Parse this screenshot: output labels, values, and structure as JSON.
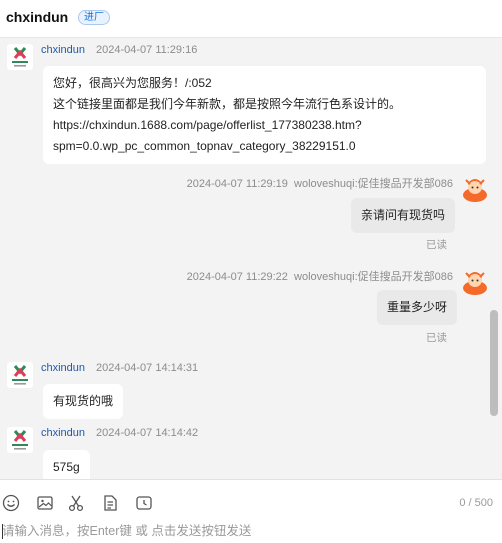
{
  "header": {
    "title": "chxindun",
    "badge": "进厂"
  },
  "messages": {
    "m1": {
      "name": "chxindun",
      "time": "2024-04-07 11:29:16",
      "lines": [
        "您好，很高兴为您服务！/:052",
        "这个链接里面都是我们今年新款，都是按照今年流行色系设计的。",
        "https://chxindun.1688.com/page/offerlist_177380238.htm?",
        "spm=0.0.wp_pc_common_topnav_category_38229151.0"
      ]
    },
    "m2": {
      "time": "2024-04-07 11:29:19",
      "name": "woloveshuqi:促佳搜品开发部086",
      "text": "亲请问有现货吗",
      "status": "已读"
    },
    "m3": {
      "time": "2024-04-07 11:29:22",
      "name": "woloveshuqi:促佳搜品开发部086",
      "text": "重量多少呀",
      "status": "已读"
    },
    "m4": {
      "name": "chxindun",
      "time": "2024-04-07 14:14:31",
      "text": "有现货的哦"
    },
    "m5": {
      "name": "chxindun",
      "time": "2024-04-07 14:14:42",
      "text": "575g"
    }
  },
  "composer": {
    "counter": "0 / 500",
    "placeholder": "请输入消息，按Enter键 或 点击发送按钮发送",
    "tools": [
      "emoji-icon",
      "image-icon",
      "scissors-icon",
      "document-icon",
      "history-icon"
    ]
  },
  "colors": {
    "name": "#1e5aa8",
    "time": "#8c8c8c",
    "seller_bubble": "#ffffff",
    "my_bubble": "#e9e9e9",
    "avatar_shop": "#2e8b57",
    "avatar_me": "#f46a2a"
  }
}
